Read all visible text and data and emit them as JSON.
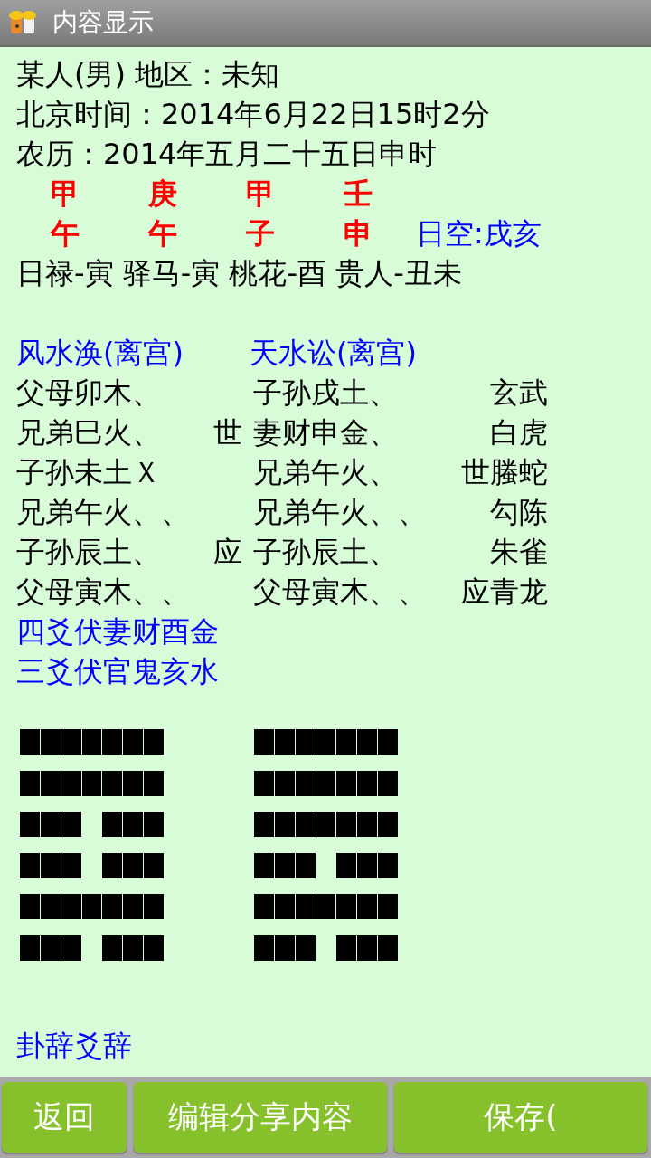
{
  "window": {
    "title": "内容显示"
  },
  "info_lines": [
    "某人(男) 地区：未知",
    "北京时间：2014年6月22日15时2分",
    "农历：2014年五月二十五日申时"
  ],
  "pillars": [
    {
      "stem": "甲",
      "branch": "午"
    },
    {
      "stem": "庚",
      "branch": "午"
    },
    {
      "stem": "甲",
      "branch": "子"
    },
    {
      "stem": "壬",
      "branch": "申"
    }
  ],
  "day_void": "日空:戌亥",
  "stars_line": "日禄-寅 驿马-寅 桃花-酉 贵人-丑未",
  "gua_titles": [
    "风水涣(离宫)",
    "天水讼(离宫)"
  ],
  "yao_rows": [
    {
      "left": "父母卯木、",
      "right": "子孙戌土、",
      "god": "玄武"
    },
    {
      "left": "兄弟巳火、",
      "left_mark": "世",
      "right": "妻财申金、",
      "god": "白虎"
    },
    {
      "left": "子孙未土Ｘ",
      "right": "兄弟午火、",
      "right_mark": "世",
      "god": "螣蛇"
    },
    {
      "left": "兄弟午火、、",
      "right": "兄弟午火、、",
      "god": "勾陈"
    },
    {
      "left": "子孙辰土、",
      "left_mark": "应",
      "right": "子孙辰土、",
      "god": "朱雀"
    },
    {
      "left": "父母寅木、、",
      "right": "父母寅木、、",
      "right_mark": "应",
      "god": "青龙"
    }
  ],
  "hidden_lines": [
    "四爻伏妻财酉金",
    "三爻伏官鬼亥水"
  ],
  "hexagrams": [
    {
      "lines": [
        {
          "kind": "yang"
        },
        {
          "kind": "yang"
        },
        {
          "kind": "yin"
        },
        {
          "kind": "yin"
        },
        {
          "kind": "yang"
        },
        {
          "kind": "yin"
        }
      ]
    },
    {
      "lines": [
        {
          "kind": "yang"
        },
        {
          "kind": "yang"
        },
        {
          "kind": "yang"
        },
        {
          "kind": "yin"
        },
        {
          "kind": "yang"
        },
        {
          "kind": "yin"
        }
      ]
    }
  ],
  "section_link": "卦辞爻辞",
  "buttons": [
    "返回",
    "编辑分享内容",
    "保存("
  ]
}
